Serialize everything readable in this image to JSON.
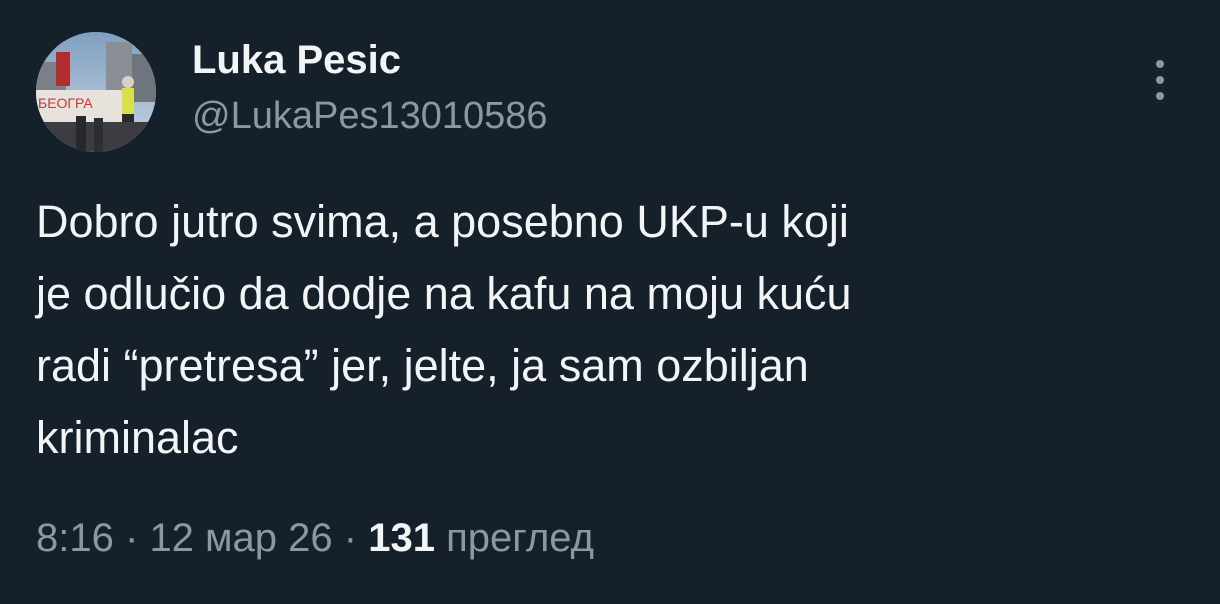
{
  "author": {
    "name": "Luka Pesic",
    "handle": "@LukaPes13010586",
    "avatar_banner_text": "БЕОГРА"
  },
  "tweet": {
    "text": "Dobro jutro svima, a posebno UKP-u koji\nje odlučio da dodje na kafu na moju kuću\nradi “pretresa” jer, jelte, ja sam ozbiljan\nkriminalac"
  },
  "meta": {
    "time": "8:16",
    "separator": "·",
    "date": "12 мар 26",
    "views_count": "131",
    "views_label": "преглед"
  },
  "icons": {
    "more": "more-vertical-icon"
  },
  "colors": {
    "background": "#15202b",
    "text_primary": "#f2f4f6",
    "text_secondary": "#8899a6"
  }
}
